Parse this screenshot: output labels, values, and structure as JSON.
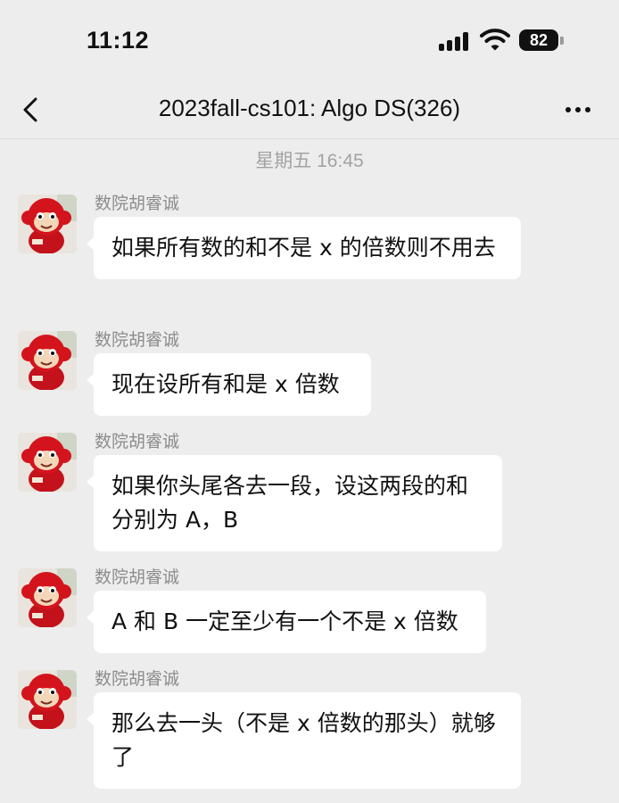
{
  "status_bar": {
    "time": "11:12",
    "battery": "82",
    "icons": [
      "signal-icon",
      "wifi-icon",
      "battery-icon"
    ]
  },
  "nav": {
    "title": "2023fall-cs101: Algo DS(326)",
    "icons": [
      "back-icon",
      "more-icon"
    ]
  },
  "timestamp": "星期五 16:45",
  "messages": [
    {
      "sender": "数院胡睿诚",
      "text": "如果所有数的和不是 x 的倍数则不用去"
    },
    {
      "sender": "数院胡睿诚",
      "text": "现在设所有和是 x 倍数"
    },
    {
      "sender": "数院胡睿诚",
      "text": "如果你头尾各去一段，设这两段的和分别为 A，B"
    },
    {
      "sender": "数院胡睿诚",
      "text": "A 和 B 一定至少有一个不是 x 倍数"
    },
    {
      "sender": "数院胡睿诚",
      "text": "那么去一头（不是 x 倍数的那头）就够了"
    }
  ],
  "colors": {
    "background": "#ededed",
    "bubble": "#ffffff",
    "sender_text": "#8c8c8c",
    "timestamp_text": "#a3a3a3",
    "avatar_accent": "#d4141c"
  }
}
